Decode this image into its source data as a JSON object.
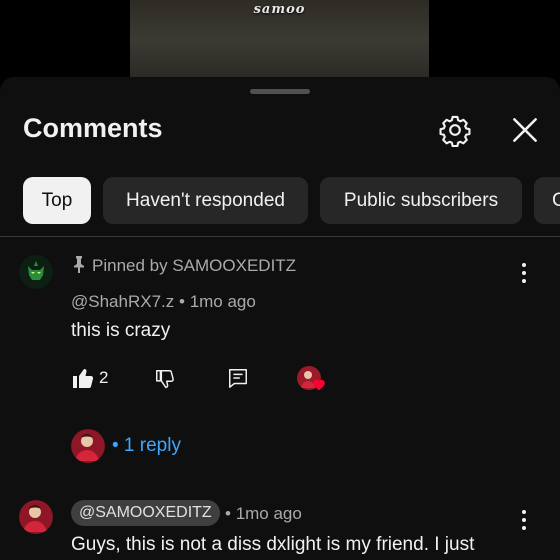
{
  "video": {
    "caption": "samoo"
  },
  "header": {
    "title": "Comments",
    "settings_icon": "gear-icon",
    "close_icon": "close-icon"
  },
  "filters": [
    "Top",
    "Haven't responded",
    "Public subscribers",
    "C"
  ],
  "pinned_comment": {
    "pinned_label": "Pinned by SAMOOXEDITZ",
    "author": "@ShahRX7.z",
    "separator": "•",
    "time": "1mo ago",
    "text": "this is crazy",
    "like_count": "2",
    "reply_link": "• 1 reply"
  },
  "second_comment": {
    "author": "@SAMOOXEDITZ",
    "separator": "•",
    "time": "1mo ago",
    "text": "Guys, this is not a diss dxlight is my friend. I just"
  },
  "colors": {
    "sheet": "#0f0f0f",
    "chip": "#272727",
    "chip_active": "#f1f1f1",
    "link": "#3ea6ff",
    "heart": "#ff0033"
  }
}
